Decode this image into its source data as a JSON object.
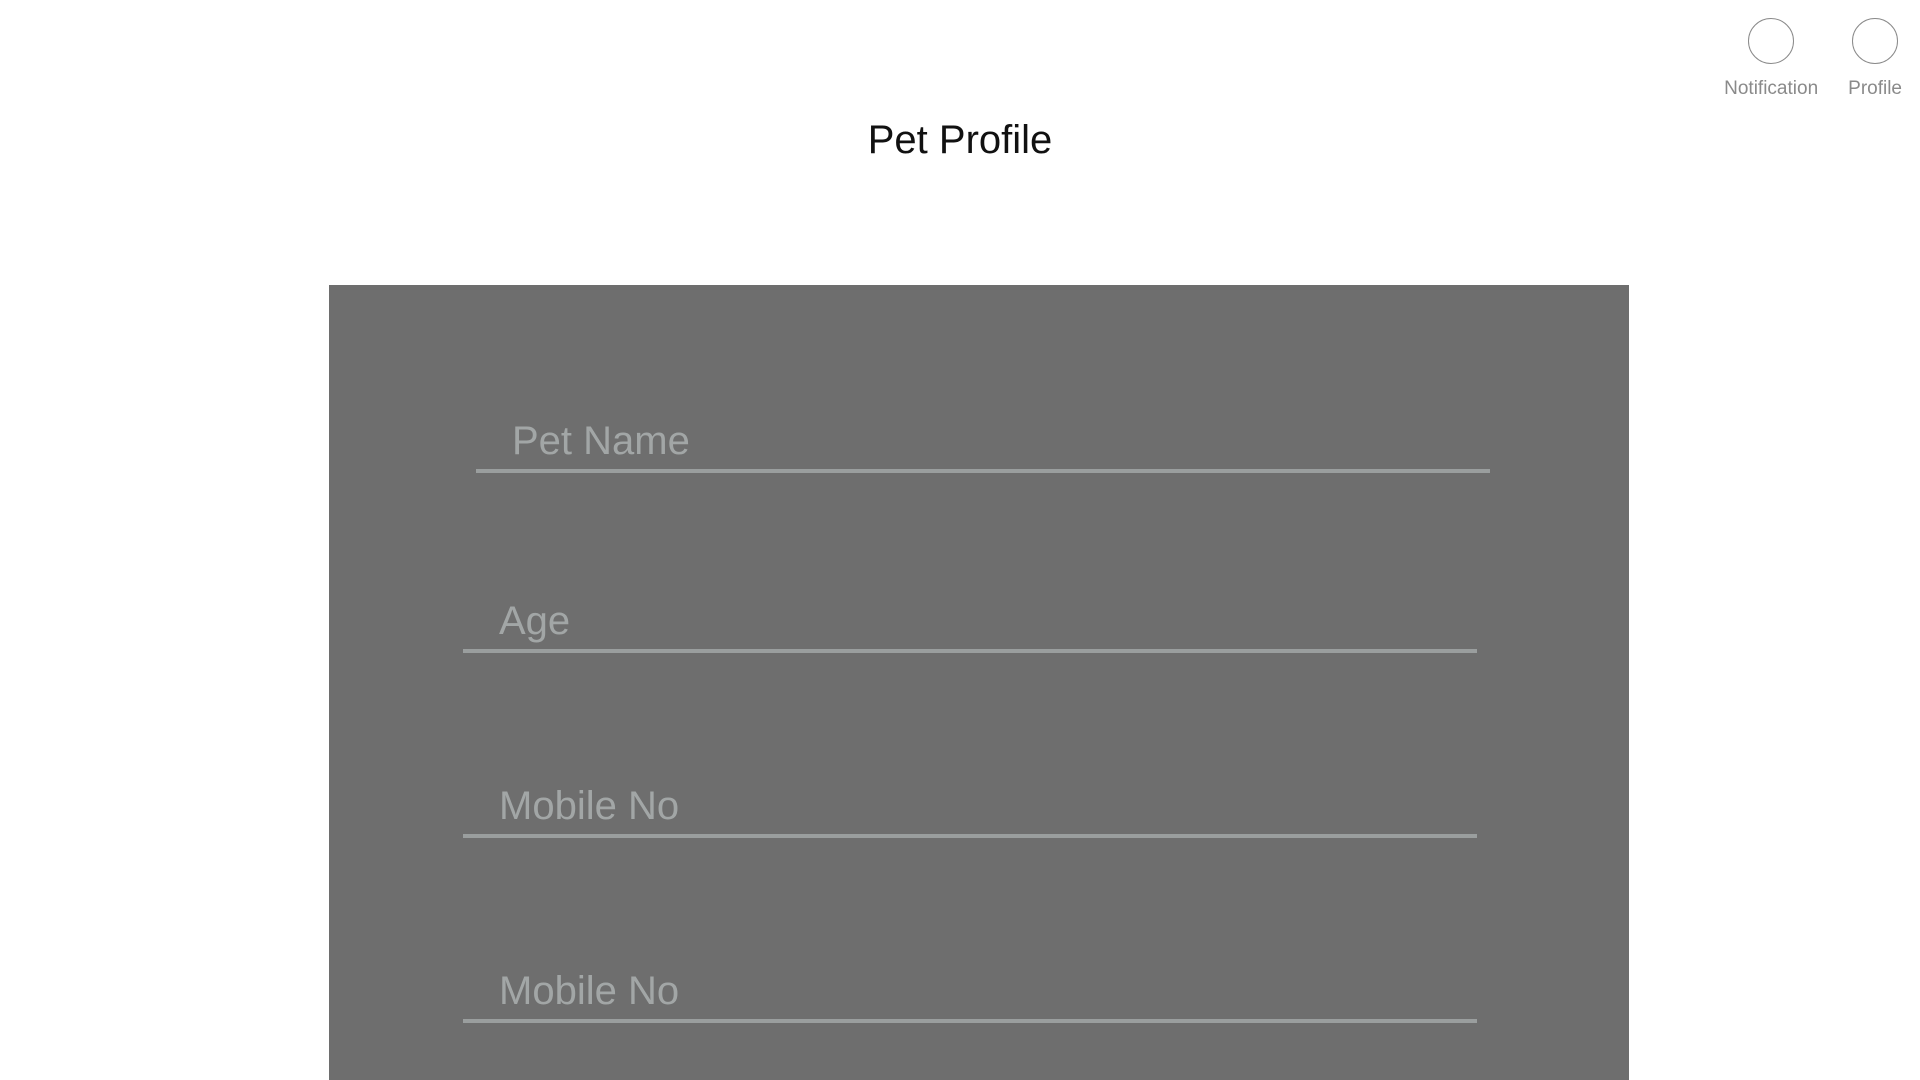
{
  "header": {
    "title": "Pet Profile",
    "actions": [
      {
        "label": "Notification",
        "icon": "notification-icon"
      },
      {
        "label": "Profile",
        "icon": "profile-icon"
      }
    ]
  },
  "form": {
    "fields": [
      {
        "placeholder": "Pet Name",
        "value": ""
      },
      {
        "placeholder": "Age",
        "value": ""
      },
      {
        "placeholder": "Mobile No",
        "value": ""
      },
      {
        "placeholder": "Mobile No",
        "value": ""
      }
    ]
  },
  "colors": {
    "panel_background": "#6e6e6e",
    "placeholder_text": "#a2a6a6",
    "underline": "#9a9e9e",
    "icon_border": "#8a8a8a"
  }
}
